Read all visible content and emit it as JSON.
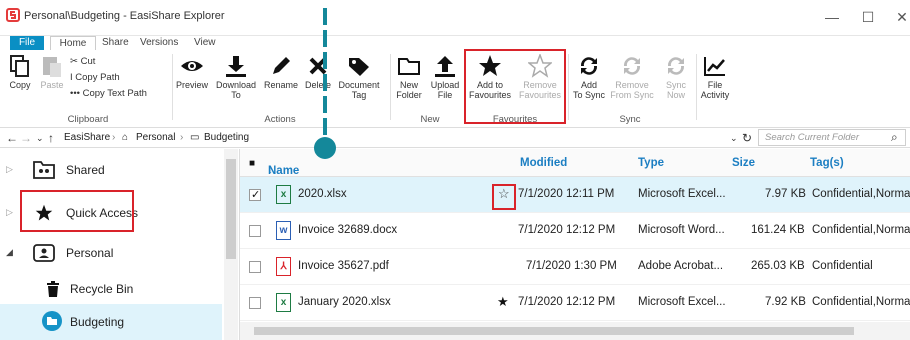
{
  "window": {
    "title": "Personal\\Budgeting - EasiShare Explorer",
    "minimize": "—",
    "maximize": "☐",
    "close": "✕"
  },
  "tabs": {
    "file": "File",
    "home": "Home",
    "share": "Share",
    "versions": "Versions",
    "view": "View"
  },
  "ribbon": {
    "clipboard": {
      "copy": "Copy",
      "paste": "Paste",
      "cut": "Cut",
      "copy_path": "Copy Path",
      "copy_text_path": "Copy Text Path",
      "group": "Clipboard"
    },
    "actions": {
      "preview": "Preview",
      "download_1": "Download",
      "download_2": "To",
      "rename": "Rename",
      "delete": "Delete",
      "doc_tag_1": "Document",
      "doc_tag_2": "Tag",
      "group": "Actions"
    },
    "new": {
      "new_folder_1": "New",
      "new_folder_2": "Folder",
      "upload_1": "Upload",
      "upload_2": "File",
      "group": "New"
    },
    "favourites": {
      "add_1": "Add to",
      "add_2": "Favourites",
      "remove_1": "Remove",
      "remove_2": "Favourites",
      "group": "Favourites"
    },
    "sync": {
      "add_1": "Add",
      "add_2": "To Sync",
      "remove_1": "Remove",
      "remove_2": "From Sync",
      "now_1": "Sync",
      "now_2": "Now",
      "group": "Sync"
    },
    "activity": {
      "label_1": "File",
      "label_2": "Activity"
    }
  },
  "address": {
    "root": "EasiShare",
    "personal": "Personal",
    "current": "Budgeting",
    "search_placeholder": "Search Current Folder"
  },
  "sidebar": {
    "items": [
      {
        "label": "Shared"
      },
      {
        "label": "Quick Access"
      },
      {
        "label": "Personal"
      },
      {
        "label": "Recycle Bin"
      },
      {
        "label": "Budgeting"
      }
    ]
  },
  "table": {
    "headers": {
      "name": "Name",
      "modified": "Modified",
      "type": "Type",
      "size": "Size",
      "tags": "Tag(s)"
    },
    "rows": [
      {
        "name": "2020.xlsx",
        "modified": "7/1/2020 12:11 PM",
        "type": "Microsoft Excel...",
        "size": "7.97 KB",
        "tags": "Confidential,Normal",
        "icon": "excel-file-icon",
        "favourite": false,
        "checked": true
      },
      {
        "name": "Invoice 32689.docx",
        "modified": "7/1/2020 12:12 PM",
        "type": "Microsoft Word...",
        "size": "161.24 KB",
        "tags": "Confidential,Normal",
        "icon": "word-file-icon",
        "favourite": false,
        "checked": false
      },
      {
        "name": "Invoice 35627.pdf",
        "modified": "7/1/2020 1:30 PM",
        "type": "Adobe Acrobat...",
        "size": "265.03 KB",
        "tags": "Confidential",
        "icon": "pdf-file-icon",
        "favourite": false,
        "checked": false
      },
      {
        "name": "January 2020.xlsx",
        "modified": "7/1/2020 12:12 PM",
        "type": "Microsoft Excel...",
        "size": "7.92 KB",
        "tags": "Confidential,Normal",
        "icon": "excel-file-icon",
        "favourite": true,
        "checked": false
      }
    ]
  },
  "colors": {
    "accent": "#1b7ec2",
    "file_tab": "#0a8fc4",
    "highlight": "#d9232a",
    "annotation": "#14889a",
    "selection": "#dff3fb"
  }
}
